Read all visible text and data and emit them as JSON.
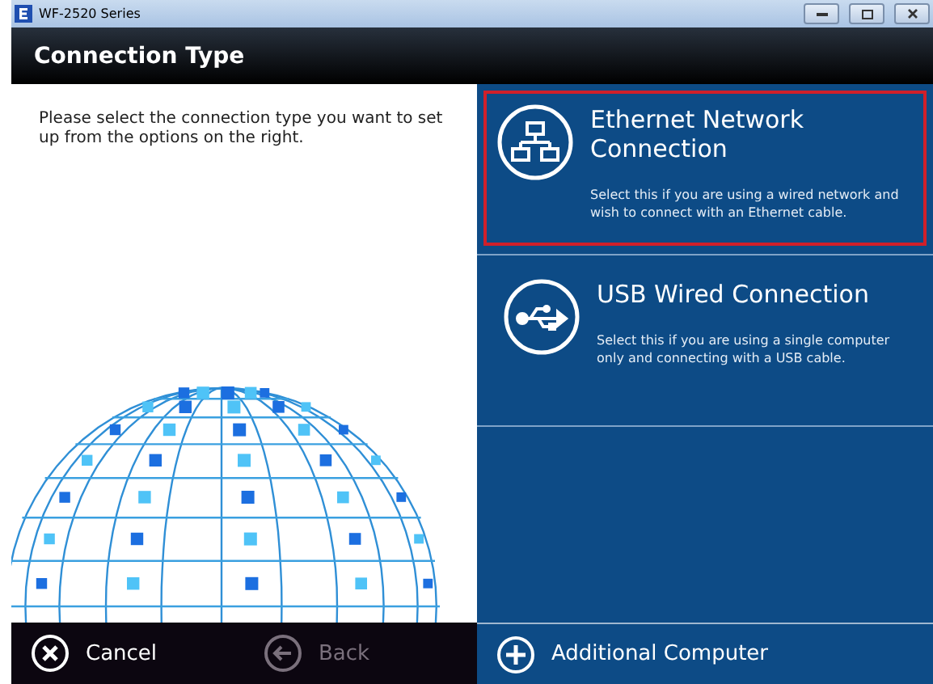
{
  "window": {
    "title": "WF-2520 Series"
  },
  "header": {
    "title": "Connection Type"
  },
  "instructions": "Please select the connection type you want to set up from the options on the right.",
  "options": [
    {
      "kind": "ethernet",
      "title": "Ethernet Network Connection",
      "description": "Select this if you are using a wired network and wish to connect with an Ethernet cable.",
      "selected": true
    },
    {
      "kind": "usb",
      "title": "USB Wired Connection",
      "description": "Select this if you are using a single computer only and connecting with a USB cable.",
      "selected": false
    }
  ],
  "footer": [
    {
      "kind": "cancel",
      "label": "Cancel",
      "disabled": false
    },
    {
      "kind": "back",
      "label": "Back",
      "disabled": true
    },
    {
      "kind": "add",
      "label": "Additional Computer",
      "disabled": false
    }
  ]
}
